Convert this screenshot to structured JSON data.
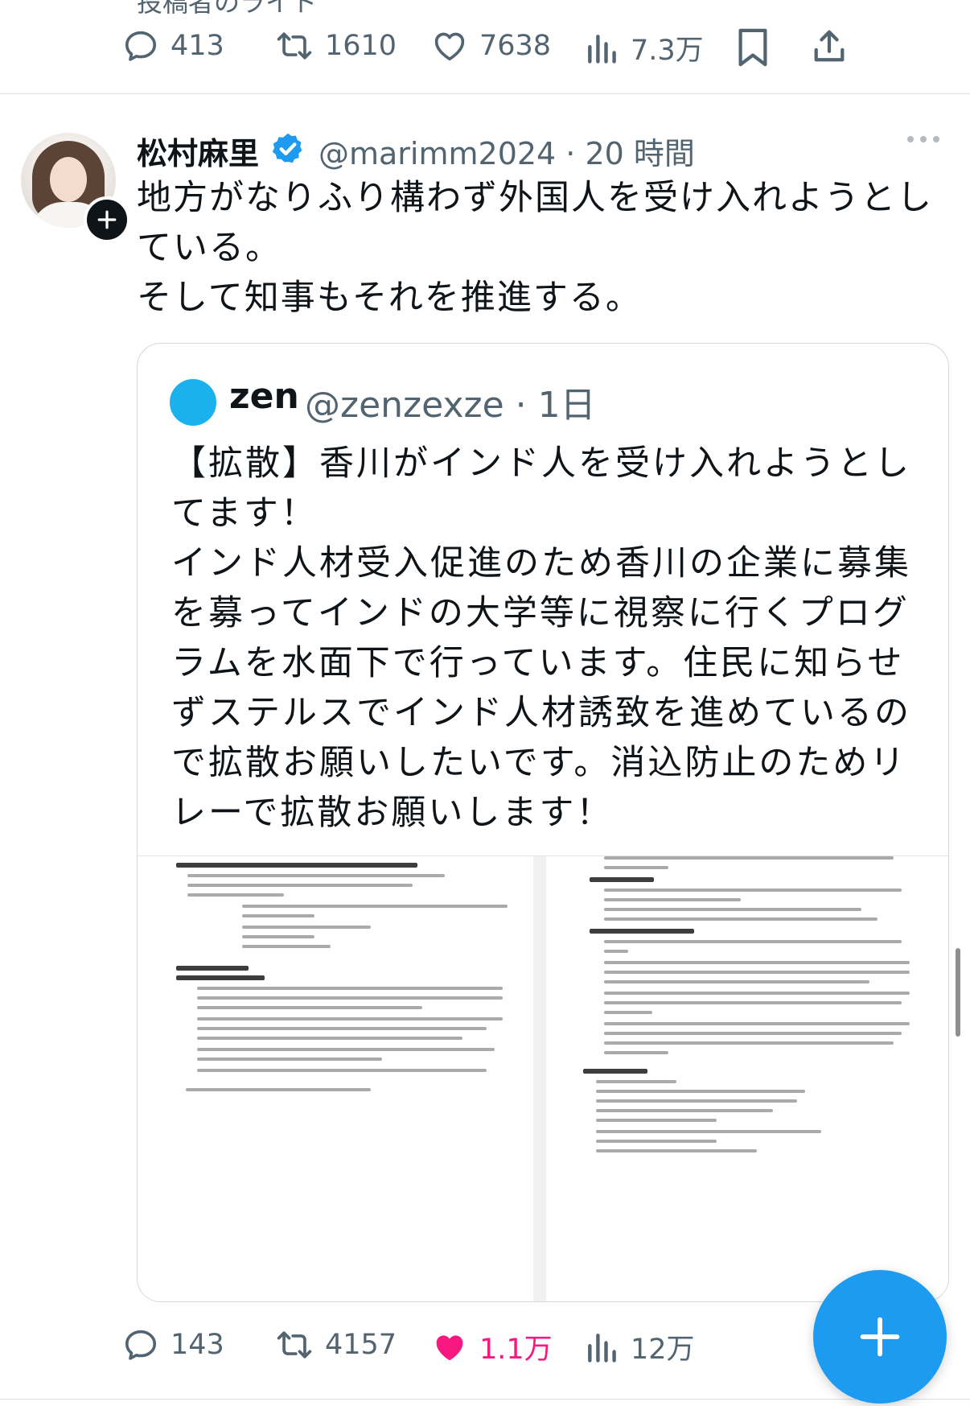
{
  "top_partial_text": "投稿者のライト",
  "prev_tweet_actions": {
    "replies": "413",
    "retweets": "1610",
    "likes": "7638",
    "views": "7.3万"
  },
  "tweet": {
    "author_name": "松村麻里",
    "handle_time": "@marimm2024 · 20 時間",
    "text": "地方がなりふり構わず外国人を受け入れようとし\nている。\nそして知事もそれを推進する。"
  },
  "quote": {
    "author_name": "zen",
    "handle_time": "@zenzexze · 1日",
    "text": "【拡散】香川がインド人を受け入れようとし\nてます！\nインド人材受入促進のため香川の企業に募集\nを募ってインドの大学等に視察に行くプログ\nラムを水面下で行っています。住民に知らせ\nずステルスでインド人材誘致を進めているの\nで拡散お願いしたいです。消込防止のためリ\nレーで拡散お願いします！"
  },
  "tweet_actions": {
    "replies": "143",
    "retweets": "4157",
    "likes": "1.1万",
    "views": "12万"
  },
  "colors": {
    "accent": "#1d9bf0",
    "like": "#f91880",
    "muted": "#536471",
    "quote_avatar": "#1ab1ec"
  },
  "icons": [
    "reply-icon",
    "retweet-icon",
    "like-icon",
    "views-icon",
    "bookmark-icon",
    "share-icon",
    "verified-badge-icon",
    "more-icon",
    "plus-icon",
    "compose-icon"
  ]
}
